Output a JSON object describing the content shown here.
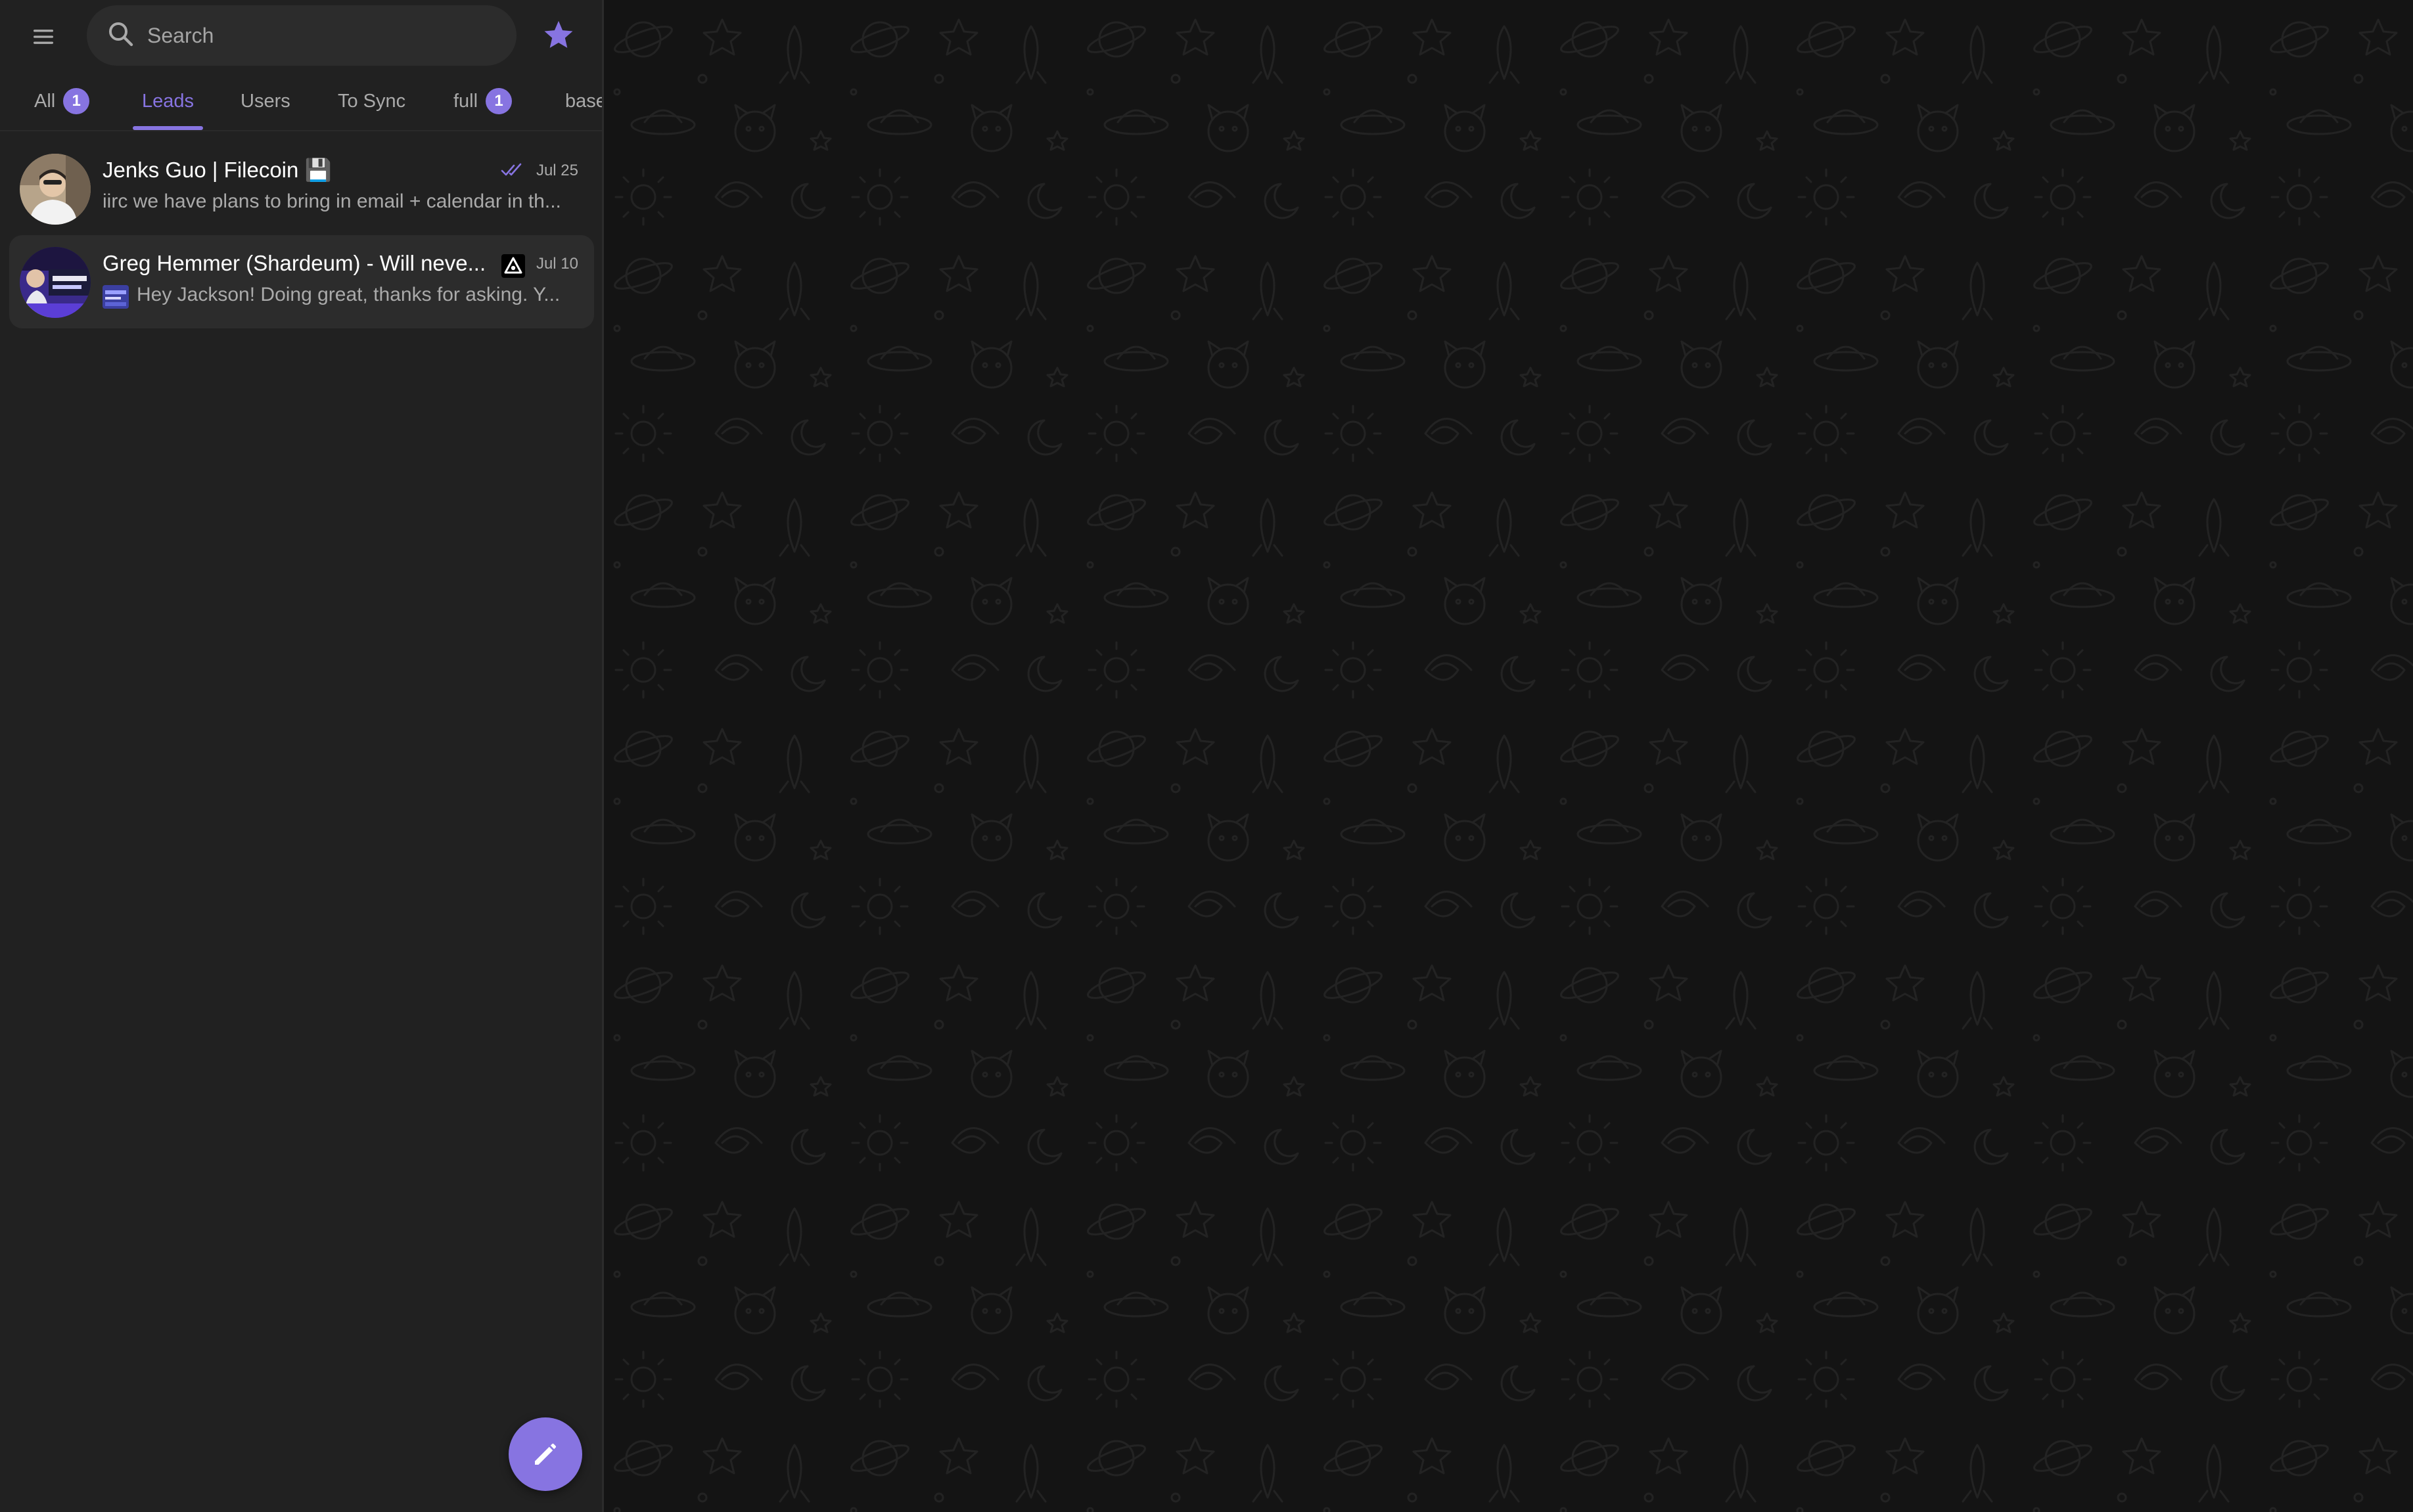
{
  "search": {
    "placeholder": "Search"
  },
  "tabs": [
    {
      "label": "All",
      "badge": "1"
    },
    {
      "label": "Leads",
      "badge": ""
    },
    {
      "label": "Users",
      "badge": ""
    },
    {
      "label": "To Sync",
      "badge": ""
    },
    {
      "label": "full",
      "badge": "1"
    },
    {
      "label": "base",
      "badge": ""
    }
  ],
  "active_tab": "Leads",
  "chats": [
    {
      "title": "Jenks Guo | Filecoin 💾",
      "preview": "iirc we have plans to bring in email + calendar in th...",
      "date": "Jul 25",
      "status_icon": "double-check-icon"
    },
    {
      "title": "Greg Hemmer (Shardeum) - Will neve...",
      "preview": "Hey Jackson! Doing great, thanks for asking. Y...",
      "date": "Jul 10",
      "status_icon": "muted-bot-icon"
    }
  ],
  "colors": {
    "accent": "#8774e1",
    "sidebar_bg": "#212121",
    "main_bg": "#141414"
  }
}
